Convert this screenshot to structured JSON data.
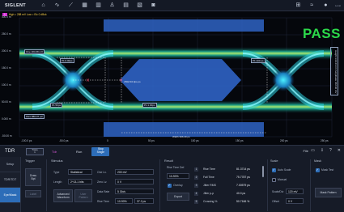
{
  "toolbar": {
    "brand": "SIGLENT",
    "icons": [
      "home-icon",
      "waveform-icon",
      "flow-icon",
      "table-icon",
      "bar-icon",
      "person-icon",
      "table-grid-icon",
      "chart-icon",
      "camera-icon"
    ],
    "right_icons": [
      "grid-icon",
      "wave-icon",
      "person-icon"
    ],
    "tiny_label": "Local"
  },
  "scope": {
    "trig_badge": "1",
    "trig_text": "High = 288 mV Low = Eic  0 dBuk",
    "pass_label": "PASS",
    "y_ticks": [
      "300.0 m",
      "250.0 m",
      "200.0 m",
      "150.0 m",
      "100.0 m",
      "50.00 m",
      "0.000 m",
      "-50.00 m"
    ],
    "x_ticks": [
      "-100.0 ps",
      "-50.0 ps",
      "0",
      "50 ps",
      "100 ps",
      "150 ps",
      "200 ps",
      "250 ps"
    ],
    "one_level": "One 184.68 mV",
    "zero_level": "Zero 886.07 µV",
    "tag_p1": "P1:0.00ps",
    "tag_p2": "P1:50ps",
    "tag_p3": "P1:100 ps",
    "tag_p4": "P1:1.00ps",
    "jitter_label": "JISM  46.0ps  ps",
    "width_label": "Width  396.49 ps",
    "side_label": "Height 130.44 mV  Amplitude 182.66 mV"
  },
  "panel": {
    "title": "TDR",
    "trace_line1": "Trace",
    "trace_line2": "1",
    "tdr_channel": "Tdr",
    "run_label": "Run",
    "stop_line1": "Stop",
    "stop_line2": "Single",
    "file_label": "File",
    "nav": [
      "Setup",
      "TDR/TDT",
      "Eye/Mask"
    ],
    "trigger": {
      "title": "Trigger",
      "draw_line1": "Draw",
      "draw_line2": "Bpt",
      "label_btn": "Label"
    },
    "stimulus": {
      "title": "Stimulus",
      "type_label": "Type",
      "type_value": "Statistical",
      "length_label": "Length",
      "length_value": "2^13-1 bits",
      "advanced_line1": "Advanced",
      "advanced_line2": "Waveform",
      "user_line1": "User",
      "user_line2": "Pattern",
      "one_lv_label": "One Lv.",
      "one_lv_value": "200 mV",
      "zero_lv_label": "Zero Lv.",
      "zero_lv_value": "0 V",
      "data_rate_label": "Data Rate",
      "data_rate_value": "5 Gb/s",
      "rise_time_label": "Rise Time",
      "rise_pct": "10-90%",
      "rise_time_value": "37.2 ps"
    },
    "result": {
      "title": "Result",
      "rise_def_label": "Rise Time Def.",
      "rise_def_value": "10-90%",
      "overlay_label": "Overlay",
      "export_label": "Export",
      "rows": [
        {
          "idx": "1",
          "label": "Rise Time",
          "value": "81.3714 ps"
        },
        {
          "idx": "2",
          "label": "Fall Time",
          "value": "75.7787 ps"
        },
        {
          "idx": "3",
          "label": "Jitter RMS",
          "value": "7.00579 ps"
        },
        {
          "idx": "4",
          "label": "Jitter p-p",
          "value": "40.0 ps"
        },
        {
          "idx": "5",
          "label": "Crossing %",
          "value": "50.7166 %"
        }
      ]
    },
    "scale": {
      "title": "Scale",
      "auto_label": "Auto Scale",
      "manual_label": "Manual",
      "scale_div_label": "Scale/Div",
      "scale_div_value": "120 mV",
      "offset_label": "Offset",
      "offset_value": "0 V"
    },
    "mask": {
      "title": "Mask",
      "mask_test_label": "Mask Test",
      "mask_pattern_label": "Mask Pattern"
    }
  },
  "colors": {
    "accent": "#2d6db8",
    "pass": "#2bd94a",
    "mask": "#2f63c4",
    "eye_core": "#3cf0ff"
  }
}
